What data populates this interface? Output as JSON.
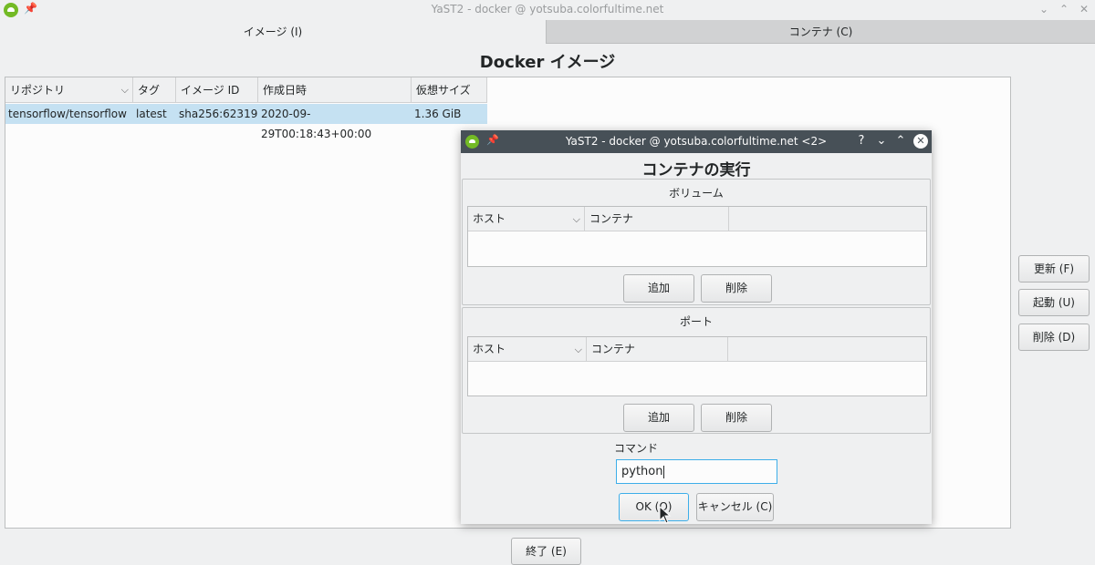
{
  "window": {
    "title": "YaST2 - docker @ yotsuba.colorfultime.net"
  },
  "tabs": [
    {
      "label": "イメージ (I)"
    },
    {
      "label": "コンテナ (C)"
    }
  ],
  "main": {
    "heading": "Docker イメージ",
    "columns": [
      "リポジトリ",
      "タグ",
      "イメージ ID",
      "作成日時",
      "仮想サイズ"
    ],
    "rows": [
      [
        "tensorflow/tensorflow",
        "latest",
        "sha256:62319",
        "2020-09-29T00:18:43+00:00",
        "1.36 GiB"
      ]
    ]
  },
  "side_buttons": {
    "refresh": "更新 (F)",
    "start": "起動 (U)",
    "delete": "削除 (D)"
  },
  "quit_button": "終了 (E)",
  "dialog": {
    "title": "YaST2 - docker @ yotsuba.colorfultime.net <2>",
    "help_glyph": "?",
    "heading": "コンテナの実行",
    "volume": {
      "title": "ボリューム",
      "columns": [
        "ホスト",
        "コンテナ"
      ],
      "add": "追加",
      "remove": "削除"
    },
    "port": {
      "title": "ポート",
      "columns": [
        "ホスト",
        "コンテナ"
      ],
      "add": "追加",
      "remove": "削除"
    },
    "command": {
      "label": "コマンド",
      "value": "python"
    },
    "ok": "OK (O)",
    "cancel": "キャンセル (C)"
  },
  "colors": {
    "accent": "#3daee9",
    "selection": "#c5e1f2",
    "dialog_titlebar": "#475057",
    "brand": "#73ba25"
  }
}
